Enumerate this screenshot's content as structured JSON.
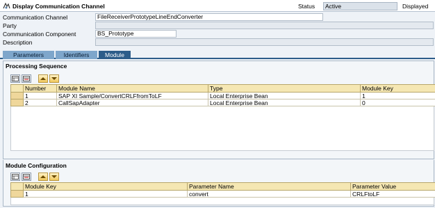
{
  "window": {
    "title": "Display Communication Channel",
    "status_label": "Status",
    "status_value": "Active",
    "displayed_label": "Displayed"
  },
  "form": {
    "channel_label": "Communication Channel",
    "channel_value": "FileReceiverPrototypeLineEndConverter",
    "party_label": "Party",
    "party_value": "",
    "component_label": "Communication Component",
    "component_value": "BS_Prototype",
    "description_label": "Description",
    "description_value": ""
  },
  "tabs": [
    {
      "label": "Parameters",
      "active": false
    },
    {
      "label": "Identifiers",
      "active": false
    },
    {
      "label": "Module",
      "active": true
    }
  ],
  "processing_sequence": {
    "title": "Processing Sequence",
    "columns": [
      "Number",
      "Module Name",
      "Type",
      "Module Key"
    ],
    "rows": [
      [
        "1",
        "SAP XI Sample/ConvertCRLFfromToLF",
        "Local Enterprise Bean",
        "1"
      ],
      [
        "2",
        "CallSapAdapter",
        "Local Enterprise Bean",
        "0"
      ]
    ]
  },
  "module_configuration": {
    "title": "Module Configuration",
    "columns": [
      "Module Key",
      "Parameter Name",
      "Parameter Value"
    ],
    "rows": [
      [
        "1",
        "convert",
        "CRLFtoLF"
      ]
    ]
  },
  "icons": {
    "title": "channel-icon",
    "insert_row": "insert-row-icon",
    "delete_row": "delete-row-icon",
    "move_up": "arrow-up-icon",
    "move_down": "arrow-down-icon"
  }
}
